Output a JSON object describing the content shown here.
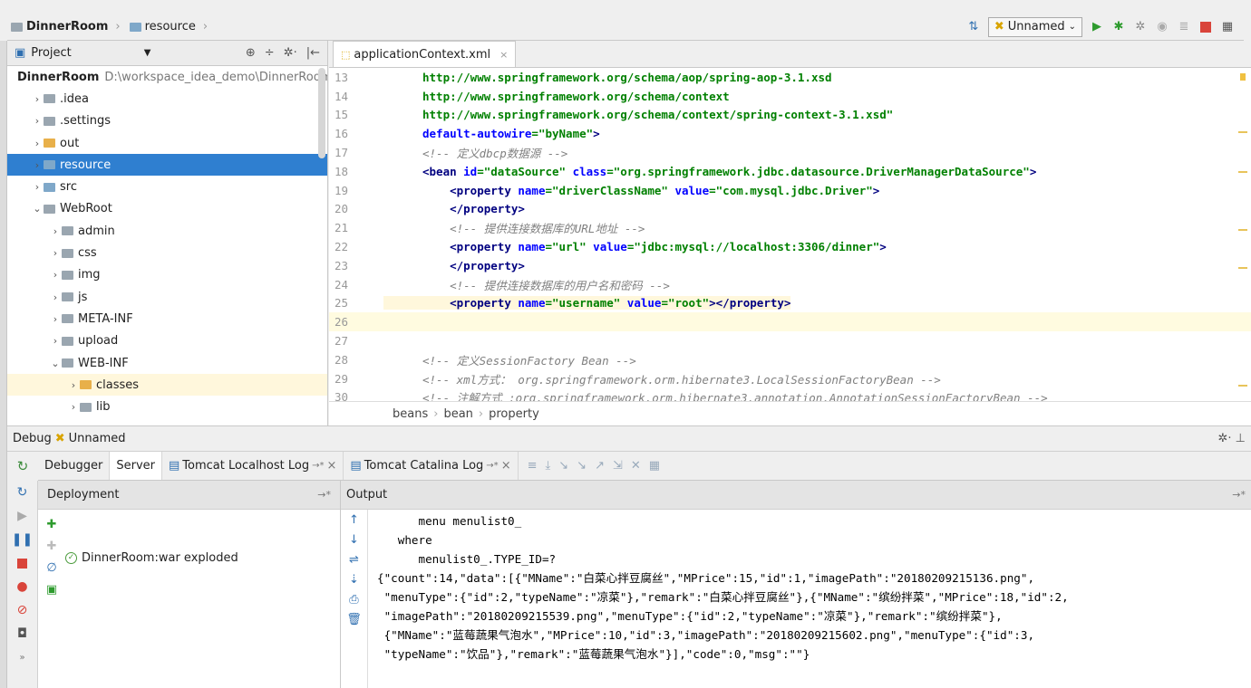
{
  "navbar": {
    "crumbs": [
      "DinnerRoom",
      "resource"
    ],
    "run_config": "Unnamed"
  },
  "project": {
    "title": "Project",
    "tree": [
      {
        "arrow": "",
        "label": "DinnerRoom",
        "path": "D:\\workspace_idea_demo\\DinnerRoom",
        "indent": 0,
        "folder": "grey",
        "bold": true
      },
      {
        "arrow": "›",
        "label": ".idea",
        "indent": 1,
        "folder": "grey"
      },
      {
        "arrow": "›",
        "label": ".settings",
        "indent": 1,
        "folder": "grey"
      },
      {
        "arrow": "›",
        "label": "out",
        "indent": 1,
        "folder": "orange"
      },
      {
        "arrow": "›",
        "label": "resource",
        "indent": 1,
        "folder": "blue",
        "selected": true
      },
      {
        "arrow": "›",
        "label": "src",
        "indent": 1,
        "folder": "blue"
      },
      {
        "arrow": "⌄",
        "label": "WebRoot",
        "indent": 1,
        "folder": "grey"
      },
      {
        "arrow": "›",
        "label": "admin",
        "indent": 2,
        "folder": "grey"
      },
      {
        "arrow": "›",
        "label": "css",
        "indent": 2,
        "folder": "grey"
      },
      {
        "arrow": "›",
        "label": "img",
        "indent": 2,
        "folder": "grey"
      },
      {
        "arrow": "›",
        "label": "js",
        "indent": 2,
        "folder": "grey"
      },
      {
        "arrow": "›",
        "label": "META-INF",
        "indent": 2,
        "folder": "grey"
      },
      {
        "arrow": "›",
        "label": "upload",
        "indent": 2,
        "folder": "grey"
      },
      {
        "arrow": "⌄",
        "label": "WEB-INF",
        "indent": 2,
        "folder": "grey"
      },
      {
        "arrow": "›",
        "label": "classes",
        "indent": 3,
        "folder": "orange",
        "highlight": true
      },
      {
        "arrow": "›",
        "label": "lib",
        "indent": 3,
        "folder": "grey"
      }
    ]
  },
  "editor": {
    "tab_label": "applicationContext.xml",
    "lines": [
      {
        "n": "13",
        "html": "<span class='plainval'>http://www.springframework.org/schema/aop/spring-aop-3.1.xsd</span>"
      },
      {
        "n": "14",
        "html": "<span class='plainval'>http://www.springframework.org/schema/context</span>"
      },
      {
        "n": "15",
        "html": "<span class='plainval'>http://www.springframework.org/schema/context/spring-context-3.1.xsd\"</span>"
      },
      {
        "n": "16",
        "html": "<span class='attr'>default-autowire</span><span class='val'>=\"byName\"</span><span class='tag'>&gt;</span>"
      },
      {
        "n": "17",
        "html": "<span class='cmt'>&lt;!-- 定义dbcp数据源 --&gt;</span>"
      },
      {
        "n": "18",
        "html": "<span class='tag'>&lt;bean </span><span class='attr'>id</span><span class='val'>=\"dataSource\" </span><span class='attr'>class</span><span class='val'>=\"org.springframework.jdbc.datasource.DriverManagerDataSource\"</span><span class='tag'>&gt;</span>"
      },
      {
        "n": "19",
        "html": "    <span class='tag'>&lt;property </span><span class='attr'>name</span><span class='val'>=\"driverClassName\" </span><span class='attr'>value</span><span class='val'>=\"com.mysql.jdbc.Driver\"</span><span class='tag'>&gt;</span>"
      },
      {
        "n": "20",
        "html": "    <span class='tag'>&lt;/property&gt;</span>"
      },
      {
        "n": "21",
        "html": "    <span class='cmt'>&lt;!-- 提供连接数据库的URL地址 --&gt;</span>"
      },
      {
        "n": "22",
        "html": "    <span class='tag'>&lt;property </span><span class='attr'>name</span><span class='val'>=\"url\" </span><span class='attr'>value</span><span class='val'>=\"jdbc:mysql://localhost:3306/dinner\"</span><span class='tag'>&gt;</span>"
      },
      {
        "n": "23",
        "html": "    <span class='tag'>&lt;/property&gt;</span>"
      },
      {
        "n": "24",
        "html": "    <span class='cmt'>&lt;!-- 提供连接数据库的用户名和密码 --&gt;</span>"
      },
      {
        "n": "25",
        "html": "    <span class='tag'>&lt;property </span><span class='attr'>name</span><span class='val'>=\"username\" </span><span class='attr'>value</span><span class='val'>=\"root\"</span><span class='tag'>&gt;&lt;/property&gt;</span>",
        "hl": true
      },
      {
        "n": "26",
        "html": "",
        "cur": true
      },
      {
        "n": "27",
        "html": ""
      },
      {
        "n": "28",
        "html": "<span class='cmt'>&lt;!-- 定义SessionFactory Bean --&gt;</span>"
      },
      {
        "n": "29",
        "html": "<span class='cmt'>&lt;!-- xml方式： org.springframework.orm.hibernate3.LocalSessionFactoryBean --&gt;</span>"
      },
      {
        "n": "30",
        "html": "<span class='cmt'>&lt;!-- 注解方式 :org.springframework.orm.hibernate3.annotation.AnnotationSessionFactoryBean --&gt;</span>"
      }
    ],
    "breadcrumb": [
      "beans",
      "bean",
      "property"
    ]
  },
  "debug": {
    "title": "Debug",
    "config": "Unnamed",
    "tabs": [
      "Debugger",
      "Server",
      "Tomcat Localhost Log",
      "Tomcat Catalina Log"
    ],
    "deployment_header": "Deployment",
    "deployment_item": "DinnerRoom:war exploded",
    "output_header": "Output",
    "output_lines": [
      "      menu menulist0_",
      "   where",
      "      menulist0_.TYPE_ID=?",
      "{\"count\":14,\"data\":[{\"MName\":\"白菜心拌豆腐丝\",\"MPrice\":15,\"id\":1,\"imagePath\":\"20180209215136.png\",",
      " \"menuType\":{\"id\":2,\"typeName\":\"凉菜\"},\"remark\":\"白菜心拌豆腐丝\"},{\"MName\":\"缤纷拌菜\",\"MPrice\":18,\"id\":2,",
      " \"imagePath\":\"20180209215539.png\",\"menuType\":{\"id\":2,\"typeName\":\"凉菜\"},\"remark\":\"缤纷拌菜\"},",
      " {\"MName\":\"蓝莓蔬果气泡水\",\"MPrice\":10,\"id\":3,\"imagePath\":\"20180209215602.png\",\"menuType\":{\"id\":3,",
      " \"typeName\":\"饮品\"},\"remark\":\"蓝莓蔬果气泡水\"}],\"code\":0,\"msg\":\"\"}"
    ]
  }
}
